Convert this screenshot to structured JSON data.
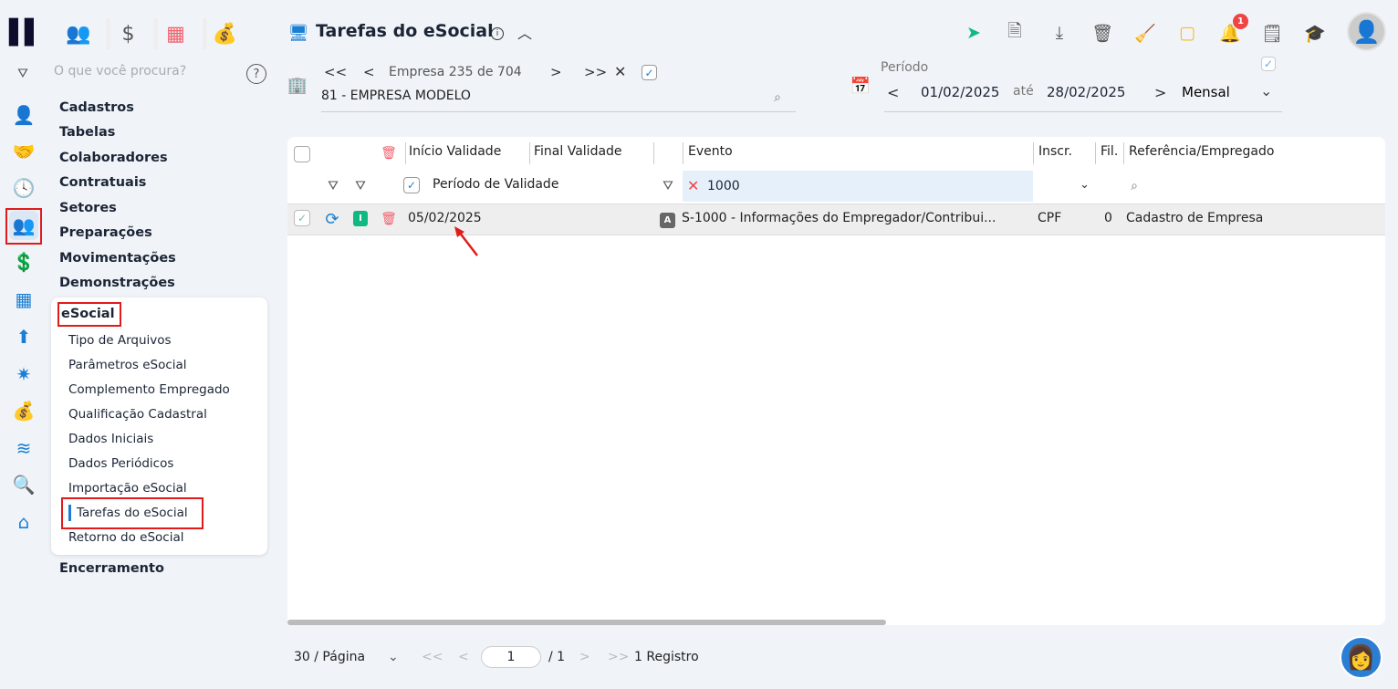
{
  "header": {
    "title": "Tarefas do eSocial",
    "info_icon": "info-icon"
  },
  "company_nav": {
    "label": "Empresa",
    "current": "235",
    "of": "de",
    "total": "704",
    "company": "81 - EMPRESA MODELO"
  },
  "period": {
    "label": "Período",
    "from": "01/02/2025",
    "until_label": "até",
    "to": "28/02/2025",
    "mode": "Mensal"
  },
  "notifications": {
    "count": "1"
  },
  "sidebar": {
    "search_placeholder": "O que você procura?",
    "menu": [
      "Cadastros",
      "Tabelas",
      "Colaboradores",
      "Contratuais",
      "Setores",
      "Preparações",
      "Movimentações",
      "Demonstrações"
    ],
    "group": "eSocial",
    "subitems": [
      "Tipo de Arquivos",
      "Parâmetros eSocial",
      "Complemento Empregado",
      "Qualificação Cadastral",
      "Dados Iniciais",
      "Dados Periódicos",
      "Importação eSocial",
      "Tarefas do eSocial",
      "Retorno do eSocial"
    ],
    "after": "Encerramento"
  },
  "table": {
    "headers": {
      "inicio": "Início Validade",
      "final": "Final Validade",
      "evento": "Evento",
      "inscr": "Inscr.",
      "fil": "Fil.",
      "ref": "Referência/Empregado"
    },
    "filters": {
      "periodo": "Período de Validade",
      "evento": "1000"
    },
    "rows": [
      {
        "status": "I",
        "inicio": "05/02/2025",
        "final": "",
        "badge": "A",
        "evento": "S-1000 - Informações do Empregador/Contribui...",
        "inscr": "CPF",
        "fil": "0",
        "ref": "Cadastro de Empresa"
      }
    ]
  },
  "pagination": {
    "per_page": "30 / Página",
    "page": "1",
    "total_pages": "/ 1",
    "records": "1 Registro"
  },
  "colors": {
    "accent": "#1a7fd4",
    "highlight": "#e01b1b",
    "status_green": "#10b981"
  }
}
